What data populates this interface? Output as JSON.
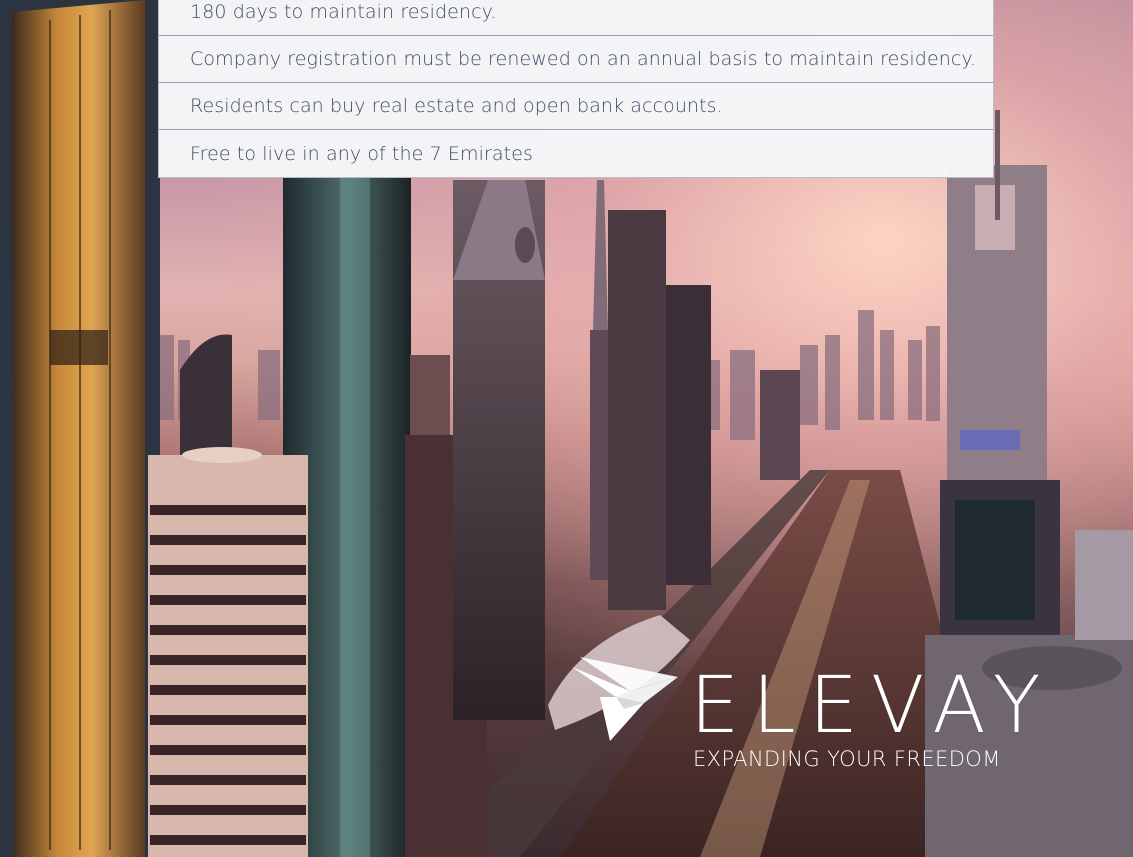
{
  "info_rows": [
    {
      "text": "180 days to maintain residency."
    },
    {
      "text": "Company registration must be renewed on an annual basis to maintain residency."
    },
    {
      "text": "Residents can buy real estate and open bank accounts."
    },
    {
      "text": "Free to live in any of the 7 Emirates"
    }
  ],
  "brand": {
    "name": "ELEVAY",
    "tagline": "EXPANDING YOUR FREEDOM",
    "logo_icon": "paper-plane-bird-icon"
  },
  "colors": {
    "row_text": "#3b4e66",
    "row_background": "#f5f6f8",
    "row_divider": "#9aa0a8",
    "frame_dark": "#2b3440",
    "brand_text": "#ffffff"
  }
}
